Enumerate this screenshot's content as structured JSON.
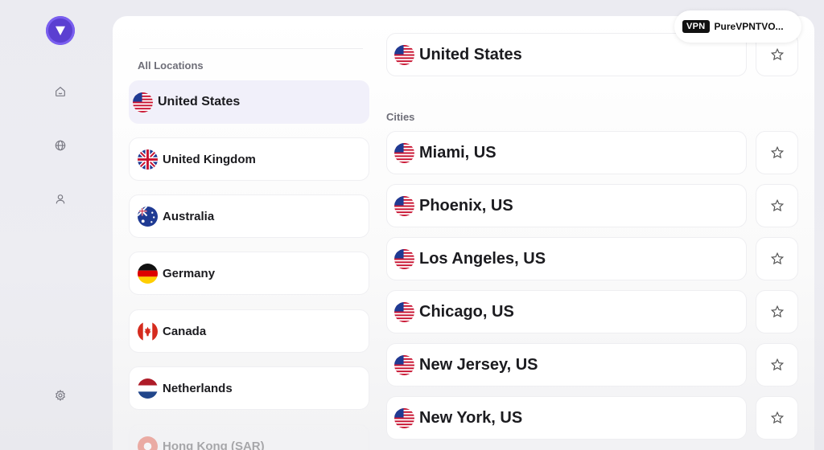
{
  "app": {
    "brand_color": "#5b3fd1"
  },
  "sidebar": {
    "icons": [
      "home-icon",
      "globe-icon",
      "user-icon",
      "gear-icon"
    ]
  },
  "locations": {
    "section_label": "All Locations",
    "items": [
      {
        "label": "United States",
        "flag": "us",
        "selected": true
      },
      {
        "label": "United Kingdom",
        "flag": "uk"
      },
      {
        "label": "Australia",
        "flag": "au"
      },
      {
        "label": "Germany",
        "flag": "de"
      },
      {
        "label": "Canada",
        "flag": "ca"
      },
      {
        "label": "Netherlands",
        "flag": "nl"
      },
      {
        "label": "Hong Kong (SAR)",
        "flag": "hk"
      }
    ]
  },
  "country_header": {
    "label": "United States",
    "flag": "us"
  },
  "cities": {
    "section_label": "Cities",
    "items": [
      {
        "label": "Miami, US"
      },
      {
        "label": "Phoenix, US"
      },
      {
        "label": "Los Angeles, US"
      },
      {
        "label": "Chicago, US"
      },
      {
        "label": "New Jersey, US"
      },
      {
        "label": "New York, US"
      }
    ]
  },
  "vpn_pill": {
    "badge": "VPN",
    "name": "PureVPNTVO..."
  }
}
